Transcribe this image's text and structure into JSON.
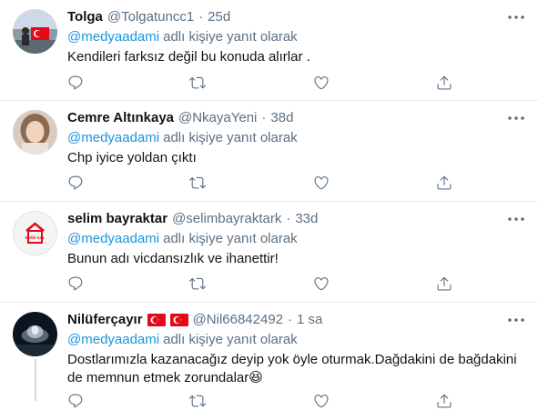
{
  "tweets": [
    {
      "name": "Tolga",
      "handle": "@Tolgatuncc1",
      "time": "25d",
      "mention": "@medyaadami",
      "reply_text": "adlı kişiye yanıt olarak",
      "text": "Kendileri farksız değil bu konuda alırlar ."
    },
    {
      "name": "Cemre Altınkaya",
      "handle": "@NkayaYeni",
      "time": "38d",
      "mention": "@medyaadami",
      "reply_text": "adlı kişiye yanıt olarak",
      "text": "Chp iyice yoldan çıktı"
    },
    {
      "name": "selim bayraktar",
      "handle": "@selimbayraktark",
      "time": "33d",
      "mention": "@medyaadami",
      "reply_text": "adlı kişiye yanıt olarak",
      "text": "Bunun adı vicdansızlık ve ihanettir!",
      "avatar_text": "EVDE KAL"
    },
    {
      "name": "Nilüferçayır",
      "handle": "@Nil66842492",
      "time": "1 sa",
      "mention": "@medyaadami",
      "reply_text": "adlı kişiye yanıt olarak",
      "text_line1": "Dostlarımızla kazanacağız deyip yok öyle oturmak.Dağdakini de bağdakini",
      "text_line2": "de memnun etmek zorundalar",
      "emoji": "😆"
    }
  ],
  "separator": "·",
  "icons": [
    "reply-icon",
    "retweet-icon",
    "like-icon",
    "share-icon",
    "more-icon",
    "turkey-flag-icon"
  ],
  "colors": {
    "link": "#1b95e0",
    "secondary": "#5b7083",
    "border": "#e6ecf0"
  }
}
